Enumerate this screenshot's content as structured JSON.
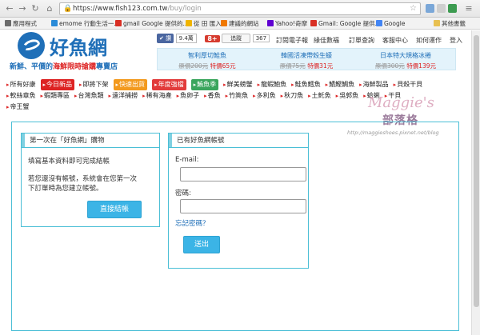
{
  "browser": {
    "url_host": "https://www.fish123.com.tw",
    "url_path": "/buy/login",
    "bookmarks": [
      {
        "label": "應用程式",
        "color": "#6b6b6b"
      },
      {
        "label": "emome 行動生活一...",
        "color": "#2a8bd8"
      },
      {
        "label": "gmail Google 提供的...",
        "color": "#d93025"
      },
      {
        "label": "從 田 匯入",
        "color": "#f0b400"
      },
      {
        "label": "建議的網站",
        "color": "#f07800"
      },
      {
        "label": "Yahoo!奇摩",
        "color": "#6001d2"
      },
      {
        "label": "Gmail: Google 提供...",
        "color": "#d93025"
      },
      {
        "label": "Google",
        "color": "#4285f4"
      },
      {
        "label": "其他書籤",
        "color": "#e8c050"
      }
    ]
  },
  "site": {
    "logo_text": "好魚網",
    "slogan_start": "新鮮、平價的",
    "slogan_mid": "海鮮限時搶購",
    "slogan_end": "專賣店",
    "like_label": "讚",
    "like_count": "9.4萬",
    "follow_label": "追蹤",
    "follow_count": "367",
    "top_links": [
      "訂閱電子報",
      "緣佳數福",
      "訂單查詢",
      "客服中心",
      "如何運作",
      "登入"
    ],
    "promos": [
      {
        "name": "智利厚切鮭魚",
        "orig": "原價200元",
        "sale": "特價65元"
      },
      {
        "name": "韓國活凍帶殼生蠔",
        "orig": "原價75元",
        "sale": "特價31元"
      },
      {
        "name": "日本特大規格冰捲",
        "orig": "原價300元",
        "sale": "特價139元"
      }
    ],
    "cat_row1": [
      {
        "label": "所有好康"
      },
      {
        "label": "今日新品",
        "bg": "#d22"
      },
      {
        "label": "即將下架"
      },
      {
        "label": "快速出貨",
        "bg": "#f39a1e"
      },
      {
        "label": "年度強檔",
        "bg": "#e23b3b"
      },
      {
        "label": "鮪魚季",
        "bg": "#3aa55d"
      },
      {
        "label": "鮮美螃蟹"
      },
      {
        "label": "龍蝦鮑魚"
      },
      {
        "label": "鮭魚鱈魚"
      },
      {
        "label": "鯖鰹鯛魚"
      },
      {
        "label": "海鮮製品"
      },
      {
        "label": "貝殼干貝"
      }
    ],
    "cat_row2": [
      {
        "label": "軟絲章魚"
      },
      {
        "label": "蝦類專區"
      },
      {
        "label": "台灣魚類"
      },
      {
        "label": "遠洋捕撈"
      },
      {
        "label": "稀有海產"
      },
      {
        "label": "魚卵子"
      },
      {
        "label": "香魚"
      },
      {
        "label": "竹筴魚"
      },
      {
        "label": "多利魚"
      },
      {
        "label": "秋刀魚"
      },
      {
        "label": "土魠魚"
      },
      {
        "label": "吳郭魚"
      },
      {
        "label": "蛤蜊"
      },
      {
        "label": "干貝"
      }
    ],
    "cat_row3": [
      {
        "label": "帝王蟹"
      }
    ]
  },
  "watermark": {
    "title": "Maggie's",
    "subtitle": "部落格",
    "url": "http://maggieshoes.pixnet.net/blog"
  },
  "signup": {
    "title": "第一次在「好魚網」購物",
    "line1": "填寫基本資料即可完成結帳",
    "line2": "若您還沒有帳號，系統會在您第一次",
    "line3": "下訂單時為您建立帳號。",
    "button": "直接結帳"
  },
  "login": {
    "title": "已有好魚網帳號",
    "email_label": "E-mail:",
    "password_label": "密碼:",
    "forgot_link": "忘記密碼？",
    "submit": "送出"
  }
}
